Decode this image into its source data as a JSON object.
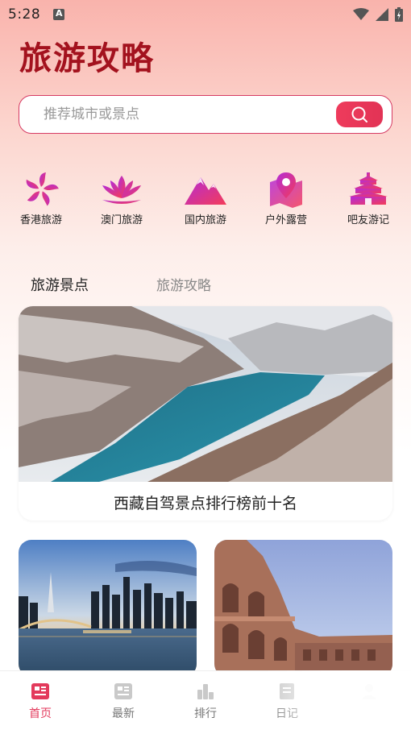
{
  "status_bar": {
    "time": "5:28"
  },
  "header": {
    "title": "旅游攻略"
  },
  "search": {
    "placeholder": "推荐城市或景点"
  },
  "categories": [
    {
      "label": "香港旅游",
      "icon": "bauhinia-icon"
    },
    {
      "label": "澳门旅游",
      "icon": "lotus-icon"
    },
    {
      "label": "国内旅游",
      "icon": "mountain-icon"
    },
    {
      "label": "户外露营",
      "icon": "map-pin-icon"
    },
    {
      "label": "吧友游记",
      "icon": "temple-icon"
    }
  ],
  "tabs": [
    {
      "label": "旅游景点",
      "active": true
    },
    {
      "label": "旅游攻略",
      "active": false
    }
  ],
  "feature": {
    "caption": "西藏自驾景点排行榜前十名"
  },
  "bottom_nav": [
    {
      "label": "首页",
      "active": true
    },
    {
      "label": "最新",
      "active": false
    },
    {
      "label": "排行",
      "active": false
    },
    {
      "label": "日记",
      "active": false
    }
  ],
  "colors": {
    "accent": "#e33a5c",
    "title": "#a3121e",
    "icon_gradient_start": "#b42bd8",
    "icon_gradient_end": "#f33c59"
  }
}
